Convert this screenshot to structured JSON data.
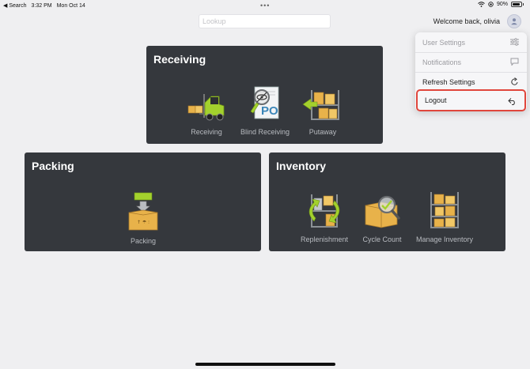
{
  "status_bar": {
    "back_label": "◀ Search",
    "time": "3:32 PM",
    "date": "Mon Oct 14",
    "dots": "•••",
    "battery_pct": "90%"
  },
  "header": {
    "lookup_placeholder": "Lookup",
    "welcome": "Welcome back, olivia"
  },
  "tiles": {
    "receiving": {
      "title": "Receiving",
      "items": [
        {
          "label": "Receiving",
          "icon": "forklift-icon"
        },
        {
          "label": "Blind Receiving",
          "icon": "blind-po-icon"
        },
        {
          "label": "Putaway",
          "icon": "shelf-boxes-icon"
        }
      ]
    },
    "packing": {
      "title": "Packing",
      "items": [
        {
          "label": "Packing",
          "icon": "packing-box-icon"
        }
      ]
    },
    "inventory": {
      "title": "Inventory",
      "items": [
        {
          "label": "Replenishment",
          "icon": "replenishment-icon"
        },
        {
          "label": "Cycle Count",
          "icon": "cycle-count-icon"
        },
        {
          "label": "Manage Inventory",
          "icon": "manage-inventory-icon"
        }
      ]
    }
  },
  "menu": {
    "items": [
      {
        "label": "User Settings",
        "icon": "sliders-icon",
        "enabled": false
      },
      {
        "label": "Notifications",
        "icon": "chat-bubble-icon",
        "enabled": false
      },
      {
        "label": "Refresh Settings",
        "icon": "refresh-icon",
        "enabled": true
      },
      {
        "label": "Logout",
        "icon": "logout-arrow-icon",
        "enabled": true,
        "highlighted": true
      }
    ]
  },
  "colors": {
    "background": "#efeff1",
    "tile": "#35383d",
    "highlight": "#e0463c",
    "icon_green": "#a3d12d",
    "icon_box": "#e8b24a"
  }
}
